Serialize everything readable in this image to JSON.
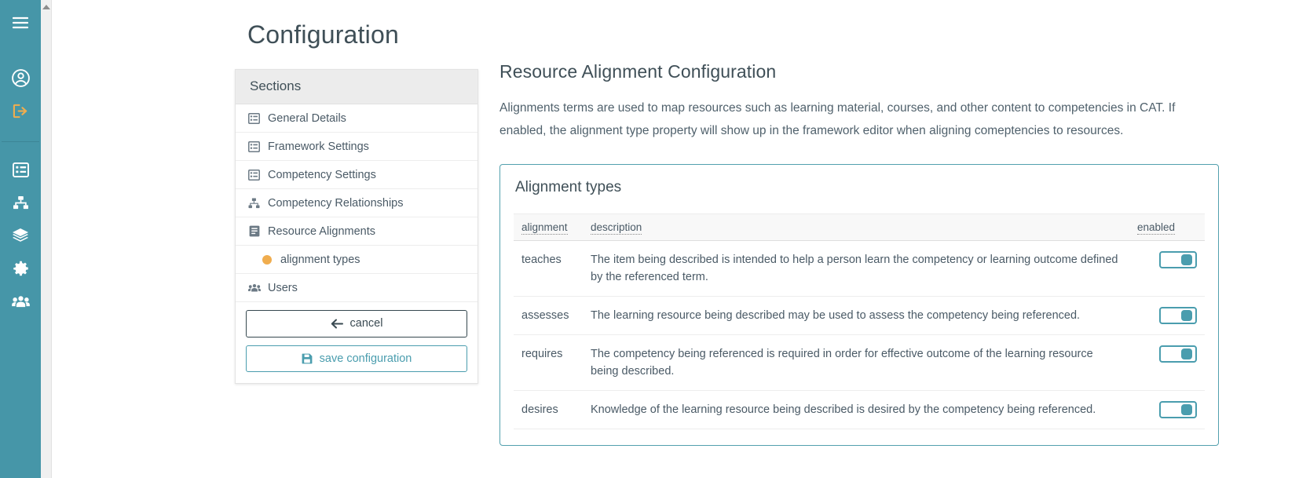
{
  "rail": {
    "items": [
      {
        "name": "menu-toggle",
        "icon": "hamburger-icon",
        "accent": false
      },
      {
        "name": "account",
        "icon": "user-circle-icon",
        "accent": false
      },
      {
        "name": "logout",
        "icon": "logout-icon",
        "accent": true
      },
      {
        "name": "frameworks",
        "icon": "list-icon",
        "accent": false
      },
      {
        "name": "competency-relationships",
        "icon": "sitemap-icon",
        "accent": false
      },
      {
        "name": "layers",
        "icon": "layers-icon",
        "accent": false
      },
      {
        "name": "configuration",
        "icon": "gear-icon",
        "accent": false
      },
      {
        "name": "users",
        "icon": "users-icon",
        "accent": false
      }
    ]
  },
  "page": {
    "title": "Configuration"
  },
  "sections": {
    "header": "Sections",
    "items": [
      {
        "label": "General Details",
        "icon": "table-icon",
        "indent": false,
        "accent": false
      },
      {
        "label": "Framework Settings",
        "icon": "table-icon",
        "indent": false,
        "accent": false
      },
      {
        "label": "Competency Settings",
        "icon": "table-icon",
        "indent": false,
        "accent": false
      },
      {
        "label": "Competency Relationships",
        "icon": "sitemap-icon",
        "indent": false,
        "accent": false
      },
      {
        "label": "Resource Alignments",
        "icon": "book-icon",
        "indent": false,
        "accent": true
      },
      {
        "label": "alignment types",
        "icon": "dot-icon",
        "indent": true,
        "accent": true
      },
      {
        "label": "Users",
        "icon": "users-icon",
        "indent": false,
        "accent": false
      }
    ],
    "cancel_label": "cancel",
    "cancel_icon": "arrow-left-icon",
    "save_label": "save configuration",
    "save_icon": "save-disk-icon"
  },
  "main": {
    "heading": "Resource Alignment Configuration",
    "lead": "Alignments terms are used to map resources such as learning material, courses, and other content to competencies in CAT. If enabled, the alignment type property will show up in the framework editor when aligning comeptencies to resources.",
    "panel_title": "Alignment types",
    "table": {
      "columns": [
        {
          "key": "alignment",
          "label": "alignment"
        },
        {
          "key": "description",
          "label": "description"
        },
        {
          "key": "enabled",
          "label": "enabled"
        }
      ],
      "rows": [
        {
          "alignment": "teaches",
          "description": "The item being described is intended to help a person learn the competency or learning outcome defined by the referenced term.",
          "enabled": true
        },
        {
          "alignment": "assesses",
          "description": "The learning resource being described may be used to assess the competency being referenced.",
          "enabled": true
        },
        {
          "alignment": "requires",
          "description": "The competency being referenced is required in order for effective outcome of the learning resource being described.",
          "enabled": true
        },
        {
          "alignment": "desires",
          "description": "Knowledge of the learning resource being described is desired by the competency being referenced.",
          "enabled": true
        }
      ]
    }
  },
  "colors": {
    "rail_bg": "#4696a8",
    "accent_orange": "#f0ad4e",
    "teal": "#4a9dae",
    "panel_border": "#53a0ae",
    "text": "#4a5a66",
    "heading": "#3f4f57"
  }
}
